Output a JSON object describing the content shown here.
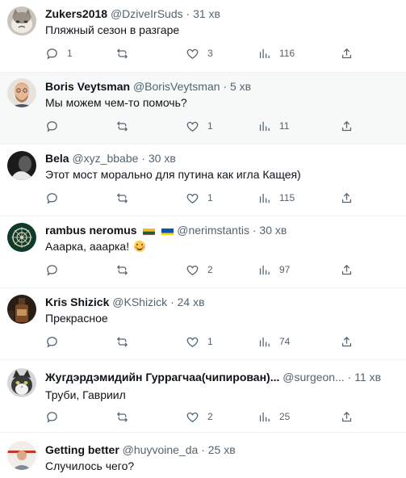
{
  "tweets": [
    {
      "name": "Zukers2018",
      "handle": "@DziveIrSuds",
      "time": "31 хв",
      "text": "Пляжный сезон в разгаре",
      "replies": "1",
      "retweets": "",
      "likes": "3",
      "views": "116",
      "avatar": "cat-avatar"
    },
    {
      "name": "Boris Veytsman",
      "handle": "@BorisVeytsman",
      "time": "5 хв",
      "text": "Мы можем чем-то помочь?",
      "replies": "",
      "retweets": "",
      "likes": "1",
      "views": "11",
      "avatar": "man-avatar"
    },
    {
      "name": "Bela",
      "handle": "@xyz_bbabe",
      "time": "30 хв",
      "text": "Этот мост морально для путина как игла Кащея)",
      "replies": "",
      "retweets": "",
      "likes": "1",
      "views": "115",
      "avatar": "dark-avatar"
    },
    {
      "name": "rambus neromus",
      "handle": "@nerimstantis",
      "time": "30 хв",
      "text": "Ааарка, ааарка!",
      "replies": "",
      "retweets": "",
      "likes": "2",
      "views": "97",
      "avatar": "ornament-avatar"
    },
    {
      "name": "Kris Shizick",
      "handle": "@KShizick",
      "time": "24 хв",
      "text": "Прекрасное",
      "replies": "",
      "retweets": "",
      "likes": "1",
      "views": "74",
      "avatar": "bottle-avatar"
    },
    {
      "name": "Жугдэрдэмидийн Гуррагчаа(чипирован)...",
      "handle": "@surgeon...",
      "time": "11 хв",
      "text": "Труби, Гавриил",
      "replies": "",
      "retweets": "",
      "likes": "2",
      "views": "25",
      "avatar": "grey-cat-avatar"
    },
    {
      "name": "Getting better",
      "handle": "@huyvoine_da",
      "time": "25 хв",
      "text": "Случилось чего?",
      "avatar": "person-avatar"
    }
  ],
  "separator": "·",
  "colors": {
    "text": "#0f1419",
    "secondary": "#536471",
    "highlight_row": "#f7f9f9",
    "divider": "#eff3f4"
  },
  "icons": [
    "reply-icon",
    "retweet-icon",
    "like-icon",
    "views-icon",
    "share-icon"
  ]
}
